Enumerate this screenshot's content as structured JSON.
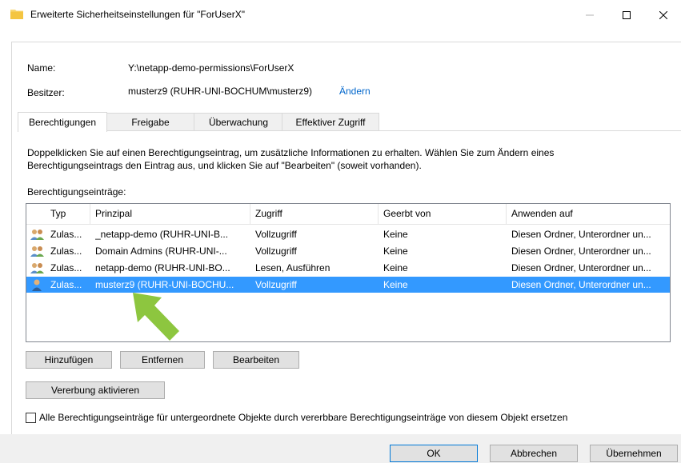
{
  "window": {
    "title": "Erweiterte Sicherheitseinstellungen für \"ForUserX\"",
    "minimize_icon": "minimize-icon",
    "maximize_icon": "maximize-icon",
    "close_icon": "close-icon"
  },
  "properties": {
    "name_label": "Name:",
    "name_value": "Y:\\netapp-demo-permissions\\ForUserX",
    "owner_label": "Besitzer:",
    "owner_value": "musterz9 (RUHR-UNI-BOCHUM\\musterz9)",
    "owner_change_link": "Ändern"
  },
  "tabs": [
    {
      "label": "Berechtigungen",
      "active": true
    },
    {
      "label": "Freigabe",
      "active": false
    },
    {
      "label": "Überwachung",
      "active": false
    },
    {
      "label": "Effektiver Zugriff",
      "active": false
    }
  ],
  "description": "Doppelklicken Sie auf einen Berechtigungseintrag, um zusätzliche Informationen zu erhalten. Wählen Sie zum Ändern eines Berechtigungseintrags den Eintrag aus, und klicken Sie auf \"Bearbeiten\" (soweit vorhanden).",
  "entries_label": "Berechtigungseinträge:",
  "table": {
    "columns": [
      "Typ",
      "Prinzipal",
      "Zugriff",
      "Geerbt von",
      "Anwenden auf"
    ],
    "rows": [
      {
        "icon": "group-users-icon",
        "type": "Zulas...",
        "principal": "_netapp-demo (RUHR-UNI-B...",
        "access": "Vollzugriff",
        "inherited": "Keine",
        "applies": "Diesen Ordner, Unterordner un...",
        "selected": false
      },
      {
        "icon": "group-users-icon",
        "type": "Zulas...",
        "principal": "Domain Admins (RUHR-UNI-...",
        "access": "Vollzugriff",
        "inherited": "Keine",
        "applies": "Diesen Ordner, Unterordner un...",
        "selected": false
      },
      {
        "icon": "group-users-icon",
        "type": "Zulas...",
        "principal": "netapp-demo (RUHR-UNI-BO...",
        "access": "Lesen, Ausführen",
        "inherited": "Keine",
        "applies": "Diesen Ordner, Unterordner un...",
        "selected": false
      },
      {
        "icon": "single-user-icon",
        "type": "Zulas...",
        "principal": "musterz9 (RUHR-UNI-BOCHU...",
        "access": "Vollzugriff",
        "inherited": "Keine",
        "applies": "Diesen Ordner, Unterordner un...",
        "selected": true
      }
    ]
  },
  "buttons": {
    "add": "Hinzufügen",
    "remove": "Entfernen",
    "edit": "Bearbeiten",
    "enable_inheritance": "Vererbung aktivieren",
    "ok": "OK",
    "cancel": "Abbrechen",
    "apply": "Übernehmen"
  },
  "replace_checkbox": {
    "label": "Alle Berechtigungseinträge für untergeordnete Objekte durch vererbbare Berechtigungseinträge von diesem Objekt ersetzen",
    "checked": false
  },
  "colors": {
    "selection": "#3399ff",
    "link": "#0066cc",
    "annotation_arrow": "#8dc63f"
  }
}
